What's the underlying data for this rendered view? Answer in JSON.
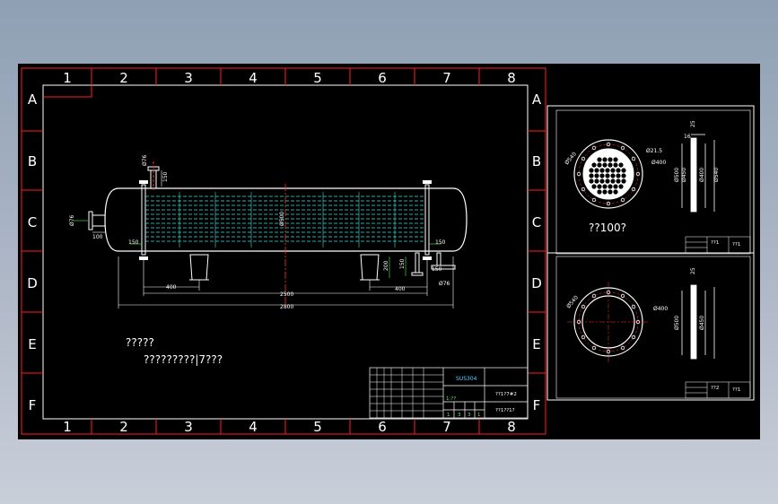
{
  "sheet": {
    "column_labels": [
      "1",
      "2",
      "3",
      "4",
      "5",
      "6",
      "7",
      "8"
    ],
    "row_labels": [
      "A",
      "B",
      "C",
      "D",
      "E",
      "F"
    ]
  },
  "main_view": {
    "dimensions": {
      "nozzle_left": "Ø76",
      "nozzle_left_len": "100",
      "top_nozzle": "Ø76",
      "top_nozzle_len": "150",
      "left_end_gap": "150",
      "right_end_gap": "150",
      "shell_diameter": "Ø500",
      "saddle_spacing_left": "400",
      "saddle_spacing_right": "400",
      "saddle_height": "200",
      "nozzle_bottom_a": "150",
      "nozzle_bottom_b": "150",
      "bottom_nozzle": "Ø76",
      "tube_length": "2500",
      "overall_length": "2800"
    },
    "notes": {
      "heading": "?????",
      "body": "?????????|7???"
    }
  },
  "title_block": {
    "material": "SUS304",
    "drawing_name": "??1?7#2",
    "drawing_number": "??1??1?",
    "scale_label": "1:??",
    "sheet_nums": [
      "1",
      "3",
      "3",
      "1"
    ]
  },
  "detail_top": {
    "dims": [
      "Ø540",
      "Ø21.5",
      "Ø400",
      "Ø500",
      "Ø400",
      "Ø450",
      "Ø540",
      "16",
      "25"
    ],
    "caption": "??100?",
    "block_name": "??1",
    "block_code": "??1"
  },
  "detail_bottom": {
    "dims": [
      "Ø540",
      "Ø400",
      "Ø500",
      "Ø450",
      "25"
    ],
    "block_name": "??2",
    "block_code": "??1"
  }
}
